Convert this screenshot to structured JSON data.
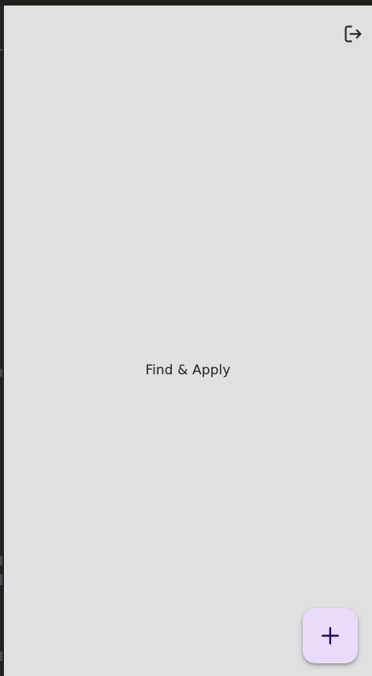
{
  "app": {
    "center_text": "Find & Apply"
  },
  "toolbar": {
    "logout_icon": "logout-icon"
  },
  "fab": {
    "icon": "add-icon",
    "background": "#eadbfb",
    "icon_color": "#21005d"
  },
  "colors": {
    "app_background": "#e0e0e0",
    "window_frame": "#1f2124",
    "text": "#222222"
  }
}
